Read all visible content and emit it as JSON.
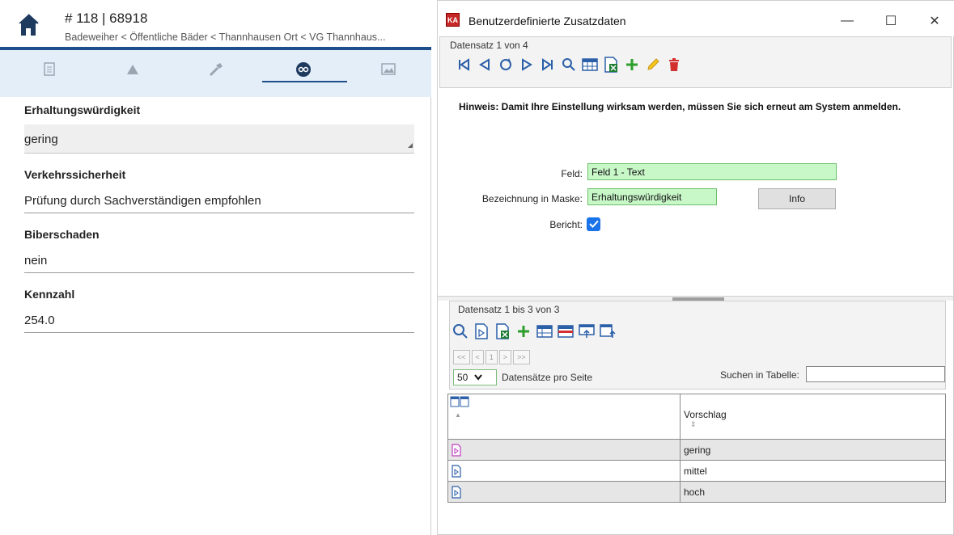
{
  "left": {
    "record_title": "# 118 | 68918",
    "record_path": "Badeweiher < Öffentliche Bäder < Thannhausen Ort < VG Thannhaus...",
    "tabs": [
      {
        "icon": "document-icon"
      },
      {
        "icon": "warning-icon"
      },
      {
        "icon": "hammer-icon"
      },
      {
        "icon": "custom-data-icon",
        "active": true
      },
      {
        "icon": "image-icon"
      }
    ],
    "fields": [
      {
        "label": "Erhaltungswürdigkeit",
        "value": "gering",
        "type": "select"
      },
      {
        "label": "Verkehrssicherheit",
        "value": "Prüfung durch Sachverständigen empfohlen",
        "type": "input"
      },
      {
        "label": "Biberschaden",
        "value": "nein",
        "type": "input"
      },
      {
        "label": "Kennzahl",
        "value": "254.0",
        "type": "input"
      }
    ]
  },
  "dialog": {
    "title": "Benutzerdefinierte Zusatzdaten",
    "controls": {
      "minimize": "—",
      "maximize": "☐",
      "close": "✕"
    },
    "record_nav_label": "Datensatz 1 von 4",
    "hint": "Hinweis: Damit Ihre Einstellung wirksam werden, müssen Sie sich erneut am System anmelden.",
    "form": {
      "feld_label": "Feld:",
      "feld_value": "Feld 1 - Text",
      "bez_label": "Bezeichnung in Maske:",
      "bez_value": "Erhaltungswürdigkeit",
      "info_button": "Info",
      "bericht_label": "Bericht:",
      "bericht_checked": true
    },
    "list": {
      "range_label": "Datensatz 1 bis 3 von 3",
      "pager": [
        "<<",
        "<",
        "1",
        ">",
        ">>"
      ],
      "per_page_value": "50",
      "per_page_label": "Datensätze pro Seite",
      "search_label": "Suchen in Tabelle:",
      "search_value": "",
      "column_header": "Vorschlag",
      "rows": [
        {
          "value": "gering"
        },
        {
          "value": "mittel"
        },
        {
          "value": "hoch"
        }
      ]
    }
  },
  "colors": {
    "accent_blue": "#1e4e8c",
    "tab_bar": "#e4eef8",
    "green_field": "#c8f7c8",
    "close_red": "#c62828"
  }
}
